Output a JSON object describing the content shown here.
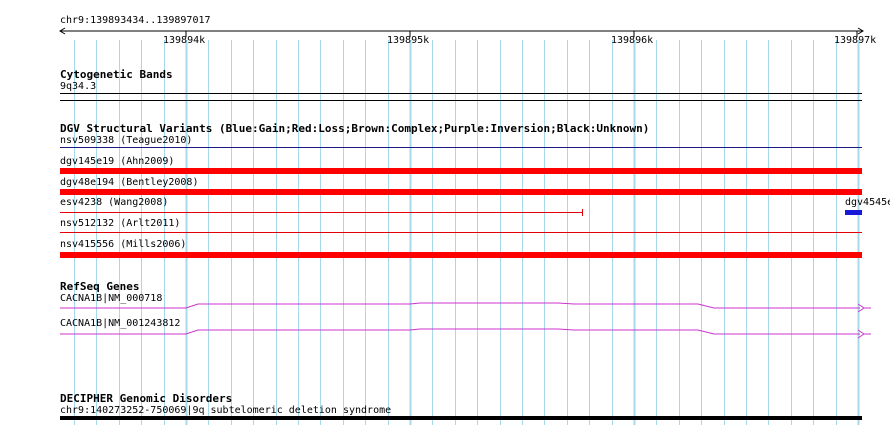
{
  "ruler": {
    "location": "chr9:139893434..139897017",
    "ticks": [
      "139894k",
      "139895k",
      "139896k",
      "139897k"
    ]
  },
  "cytogenetic": {
    "title": "Cytogenetic Bands",
    "band": "9q34.3"
  },
  "dgv": {
    "title": "DGV Structural Variants (Blue:Gain;Red:Loss;Brown:Complex;Purple:Inversion;Black:Unknown)",
    "variants": [
      {
        "label": "nsv509338 (Teague2010)",
        "type": "Gain"
      },
      {
        "label": "dgv145e19 (Ahn2009)",
        "type": "Loss"
      },
      {
        "label": "dgv48e194 (Bentley2008)",
        "type": "Loss"
      },
      {
        "label": "esv4238 (Wang2008)",
        "type": "Loss"
      },
      {
        "label": "nsv512132 (Arlt2011)",
        "type": "Loss"
      },
      {
        "label": "nsv415556 (Mills2006)",
        "type": "Loss"
      }
    ],
    "edge_label": "dgv4545e",
    "colors": {
      "gain": "#1818d8",
      "loss": "#ff0000",
      "thin_loss": "#e0000a"
    }
  },
  "refseq": {
    "title": "RefSeq Genes",
    "genes": [
      {
        "label": "CACNA1B|NM_000718"
      },
      {
        "label": "CACNA1B|NM_001243812"
      }
    ],
    "color": "#cc33cc"
  },
  "decipher": {
    "title": "DECIPHER Genomic Disorders",
    "label": "chr9:140273252-750069|9q subtelomeric deletion syndrome"
  },
  "grid_color": "#a8d8ec"
}
